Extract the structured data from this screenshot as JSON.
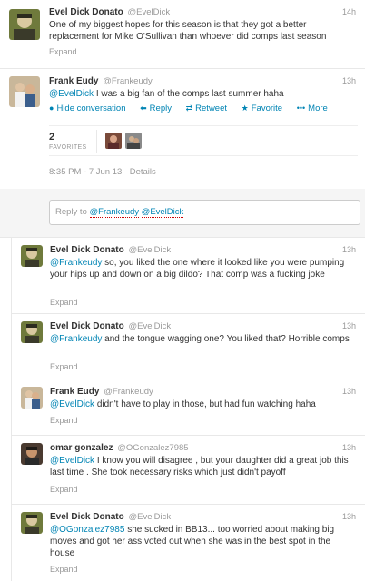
{
  "tweets": [
    {
      "name": "Evel Dick Donato",
      "handle": "@EvelDick",
      "time": "14h",
      "text": "One of my biggest hopes for this season is that they got a better replacement for Mike O'Sullivan than whoever did comps last season",
      "expand": "Expand"
    },
    {
      "name": "Frank Eudy",
      "handle": "@Frankeudy",
      "time": "13h",
      "mention": "@EvelDick",
      "text": " I was a big fan of the comps last summer haha",
      "actions": {
        "hide": "Hide conversation",
        "reply": "Reply",
        "retweet": "Retweet",
        "favorite": "Favorite",
        "more": "More"
      },
      "favorites_count": "2",
      "favorites_label": "FAVORITES",
      "timestamp": "8:35 PM - 7 Jun 13",
      "details": "Details"
    }
  ],
  "reply_box": {
    "prefix": "Reply to",
    "mention1": "@Frankeudy",
    "mention2": "@EvelDick"
  },
  "replies": [
    {
      "name": "Evel Dick Donato",
      "handle": "@EvelDick",
      "time": "13h",
      "mention": "@Frankeudy",
      "text": " so, you liked the one where it looked like you were pumping your hips up and down on a big dildo? That comp was a fucking joke",
      "expand": "Expand"
    },
    {
      "name": "Evel Dick Donato",
      "handle": "@EvelDick",
      "time": "13h",
      "mention": "@Frankeudy",
      "text": " and the tongue wagging one? You liked that? Horrible comps",
      "expand": "Expand"
    },
    {
      "name": "Frank Eudy",
      "handle": "@Frankeudy",
      "time": "13h",
      "mention": "@EvelDick",
      "text": " didn't have to play in those, but had fun watching haha",
      "expand": "Expand"
    },
    {
      "name": "omar gonzalez",
      "handle": "@OGonzalez7985",
      "time": "13h",
      "mention": "@EvelDick",
      "text": " I know you will disagree , but your daughter did a great job this last time . She took necessary risks which just didn't payoff",
      "expand": "Expand"
    },
    {
      "name": "Evel Dick Donato",
      "handle": "@EvelDick",
      "time": "13h",
      "mention": "@OGonzalez7985",
      "text": " she sucked in BB13... too worried about making big moves and got her ass voted out when she was in the best spot in the house",
      "expand": "Expand"
    }
  ],
  "colors": {
    "link": "#0084b4",
    "muted": "#999999",
    "text": "#333333",
    "border": "#e8e8e8"
  }
}
